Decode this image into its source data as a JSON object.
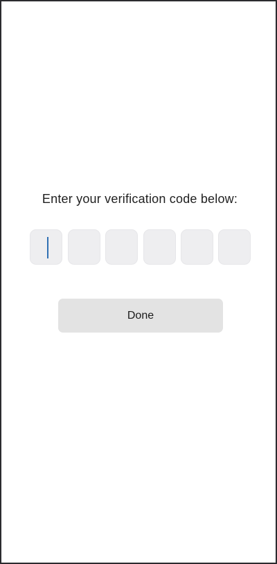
{
  "verification": {
    "prompt": "Enter your verification code below:",
    "digits": [
      "",
      "",
      "",
      "",
      "",
      ""
    ],
    "active_index": 0
  },
  "actions": {
    "done_label": "Done"
  },
  "colors": {
    "caret": "#2f6fb3",
    "box_fill": "#eeeef0",
    "button_fill": "#e3e3e3",
    "frame_border": "#2b2b2f"
  }
}
